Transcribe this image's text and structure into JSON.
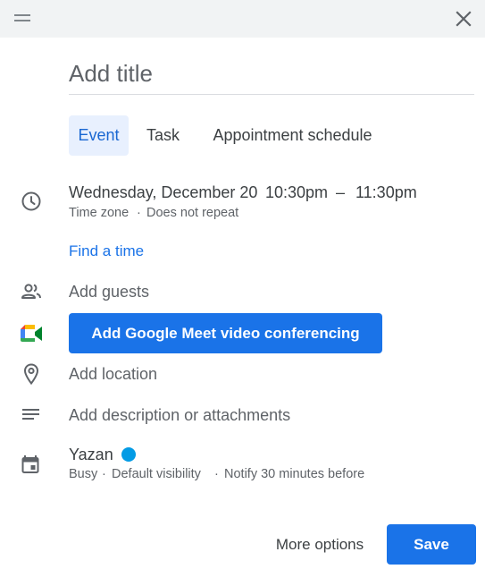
{
  "header": {
    "close_icon": "close-icon",
    "drag_icon": "drag-handle-icon"
  },
  "title": {
    "placeholder": "Add title",
    "value": ""
  },
  "tabs": [
    {
      "label": "Event",
      "active": true
    },
    {
      "label": "Task",
      "active": false
    },
    {
      "label": "Appointment schedule",
      "active": false
    }
  ],
  "time": {
    "date": "Wednesday, December 20",
    "start": "10:30pm",
    "separator": "–",
    "end": "11:30pm",
    "timezone": "Time zone",
    "dot": "·",
    "repeat": "Does not repeat",
    "icon": "clock-icon"
  },
  "find_time": "Find a time",
  "guests": {
    "label": "Add guests",
    "icon": "people-icon"
  },
  "meet": {
    "label": "Add Google Meet video conferencing",
    "icon": "google-meet-icon"
  },
  "location": {
    "label": "Add location",
    "icon": "location-pin-icon"
  },
  "description": {
    "label": "Add description or attachments",
    "icon": "notes-icon"
  },
  "calendar": {
    "name": "Yazan",
    "color": "#039be5",
    "status": "Busy",
    "visibility": "Default visibility",
    "notify": "Notify 30 minutes before",
    "dot": "·",
    "icon": "calendar-icon"
  },
  "footer": {
    "more_options": "More options",
    "save": "Save"
  },
  "colors": {
    "accent": "#1a73e8",
    "tab_active_bg": "#e8f0fe",
    "topbar_bg": "#f1f3f4"
  }
}
